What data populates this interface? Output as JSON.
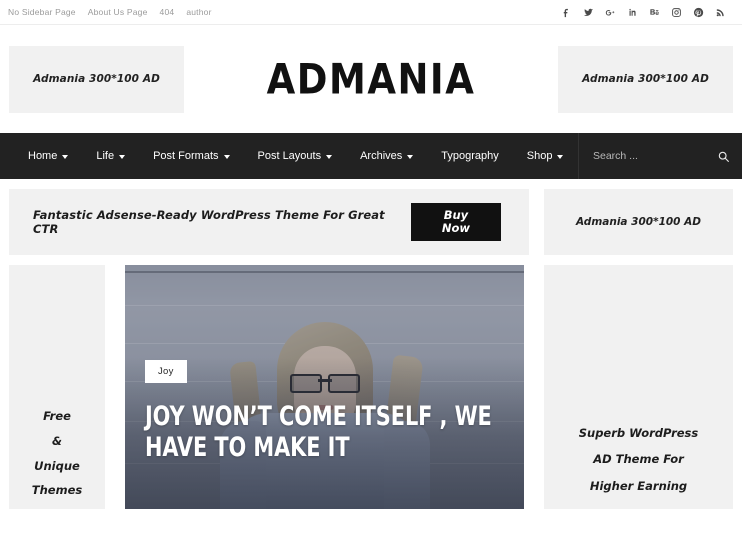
{
  "topbar": {
    "links": [
      {
        "label": "No Sidebar Page"
      },
      {
        "label": "About Us Page"
      },
      {
        "label": "404"
      },
      {
        "label": "author"
      }
    ],
    "social": [
      {
        "name": "facebook-icon",
        "glyph": "f"
      },
      {
        "name": "twitter-icon",
        "glyph": "t"
      },
      {
        "name": "google-plus-icon",
        "glyph": "g"
      },
      {
        "name": "linkedin-icon",
        "glyph": "in"
      },
      {
        "name": "behance-icon",
        "glyph": "be"
      },
      {
        "name": "instagram-icon",
        "glyph": "ig"
      },
      {
        "name": "pinterest-icon",
        "glyph": "p"
      },
      {
        "name": "rss-icon",
        "glyph": "rss"
      }
    ]
  },
  "header": {
    "logo": "ADMANIA",
    "ad_left": "Admania 300*100 AD",
    "ad_right": "Admania 300*100 AD"
  },
  "nav": {
    "items": [
      {
        "label": "Home",
        "has_dropdown": true
      },
      {
        "label": "Life",
        "has_dropdown": true
      },
      {
        "label": "Post Formats",
        "has_dropdown": true
      },
      {
        "label": "Post Layouts",
        "has_dropdown": true
      },
      {
        "label": "Archives",
        "has_dropdown": true
      },
      {
        "label": "Typography",
        "has_dropdown": false
      },
      {
        "label": "Shop",
        "has_dropdown": true
      }
    ],
    "search_placeholder": "Search ...",
    "search_value": "",
    "bar_color": "#222222"
  },
  "promo": {
    "text": "Fantastic Adsense-Ready WordPress Theme For Great CTR",
    "button_label": "Buy Now",
    "ad_right": "Admania 300*100 AD"
  },
  "sidebar_left": {
    "line1": "Free",
    "line2": "&",
    "line3": "Unique",
    "line4": "Themes"
  },
  "sidebar_right": {
    "line1": "Superb WordPress",
    "line2": "AD Theme For",
    "line3": "Higher Earning"
  },
  "hero": {
    "category": "Joy",
    "title": "JOY WON’T COME ITSELF , WE HAVE TO MAKE IT"
  },
  "colors": {
    "nav_bg": "#222222",
    "ad_bg": "#f1f1f1",
    "accent_dark": "#111111",
    "top_text": "#9b9b9b"
  }
}
